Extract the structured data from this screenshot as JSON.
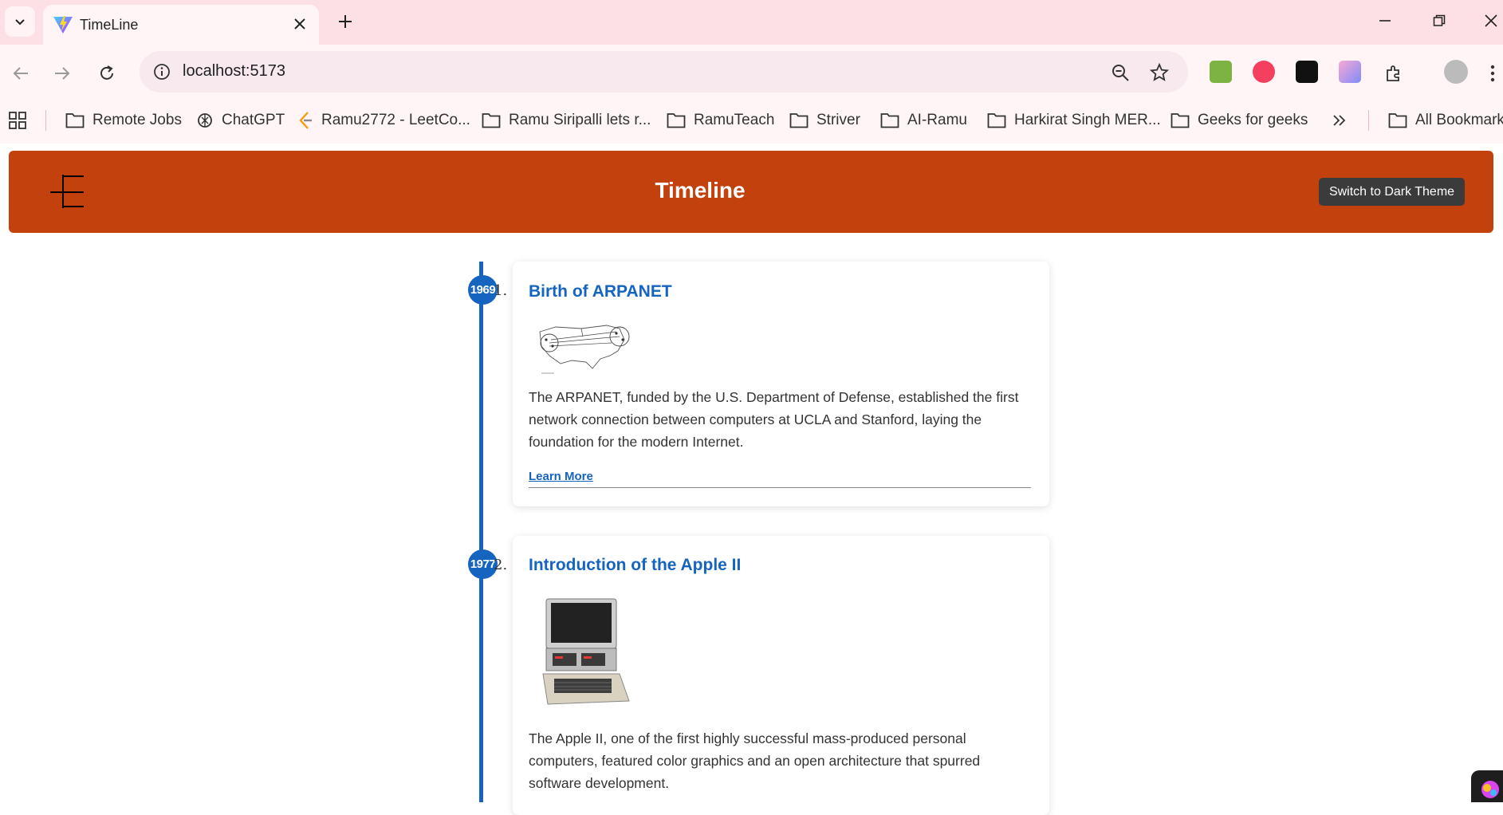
{
  "browser": {
    "tab_title": "TimeLine",
    "url": "localhost:5173",
    "bookmarks": [
      {
        "label": "Remote Jobs",
        "icon": "folder-icon"
      },
      {
        "label": "ChatGPT",
        "icon": "chatgpt-icon"
      },
      {
        "label": "Ramu2772 - LeetCo...",
        "icon": "leetcode-icon"
      },
      {
        "label": "Ramu Siripalli lets r...",
        "icon": "folder-icon"
      },
      {
        "label": "RamuTeach",
        "icon": "folder-icon"
      },
      {
        "label": "Striver",
        "icon": "folder-icon"
      },
      {
        "label": "AI-Ramu",
        "icon": "folder-icon"
      },
      {
        "label": "Harkirat Singh MER...",
        "icon": "folder-icon"
      },
      {
        "label": "Geeks for geeks",
        "icon": "folder-icon"
      }
    ],
    "all_bookmarks": "All Bookmarks"
  },
  "header": {
    "title": "Timeline",
    "theme_button": "Switch to Dark Theme"
  },
  "timeline": [
    {
      "year": "1969",
      "index": "1.",
      "title": "Birth of ARPANET",
      "image": "arpanet-map",
      "description": "The ARPANET, funded by the U.S. Department of Defense, established the first network connection between computers at UCLA and Stanford, laying the foundation for the modern Internet.",
      "link": "Learn More"
    },
    {
      "year": "1977",
      "index": "2.",
      "title": "Introduction of the Apple II",
      "image": "apple-ii-computer",
      "description": "The Apple II, one of the first highly successful mass-produced personal computers, featured color graphics and an open architecture that spurred software development."
    }
  ],
  "colors": {
    "header_bg": "#c2410c",
    "accent": "#1565c0",
    "tabbar_bg": "#fde0e6"
  }
}
